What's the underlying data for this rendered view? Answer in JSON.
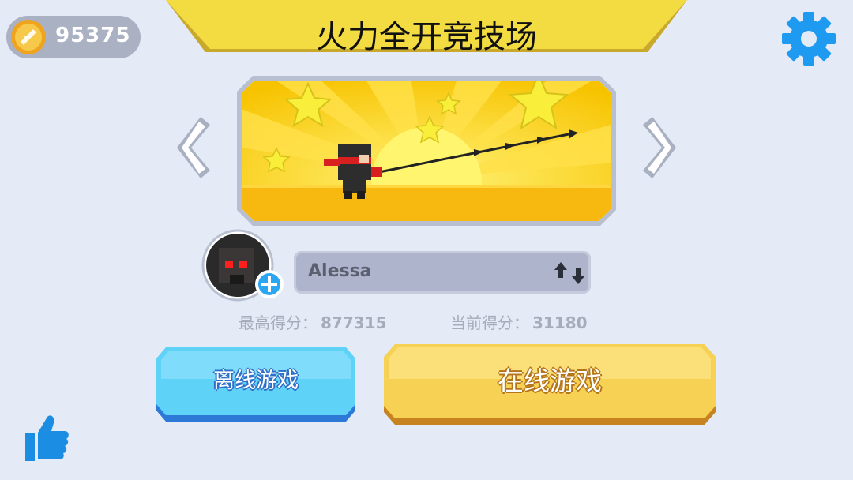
{
  "header": {
    "title": "火力全开竞技场",
    "coins": "95375"
  },
  "player": {
    "name": "Alessa",
    "best_score_label": "最高得分：",
    "best_score": "877315",
    "current_score_label": "当前得分：",
    "current_score": "31180"
  },
  "buttons": {
    "offline": "离线游戏",
    "online": "在线游戏"
  },
  "icons": {
    "coin": "coin-icon",
    "settings": "gear-icon",
    "prev": "chevron-left-icon",
    "next": "chevron-right-icon",
    "swap": "swap-icon",
    "add": "plus-icon",
    "like": "thumbs-up-icon"
  },
  "colors": {
    "banner": "#f2da3c",
    "offline_button": "#5fd2f8",
    "online_button": "#f7d154",
    "settings": "#1e9bf0"
  }
}
